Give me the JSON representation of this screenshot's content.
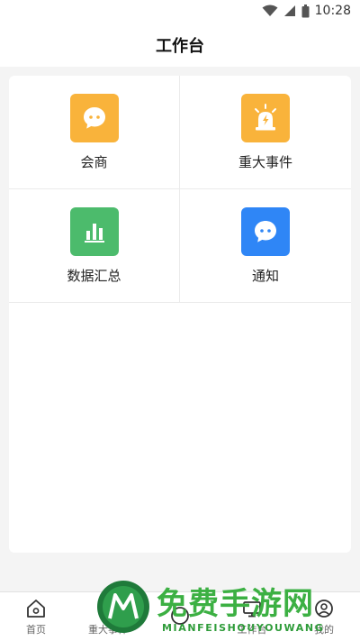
{
  "status_bar": {
    "time": "10:28",
    "icons": [
      "wifi-icon",
      "signal-icon",
      "battery-icon"
    ]
  },
  "header": {
    "title": "工作台"
  },
  "tiles": [
    {
      "label": "会商",
      "icon": "chat-bubble-icon",
      "color": "#f9b33b"
    },
    {
      "label": "重大事件",
      "icon": "alarm-light-icon",
      "color": "#f9b33b"
    },
    {
      "label": "数据汇总",
      "icon": "bar-chart-icon",
      "color": "#4cbb6c"
    },
    {
      "label": "通知",
      "icon": "message-icon",
      "color": "#2f86f6"
    }
  ],
  "bottom_nav": {
    "items": [
      {
        "label": "首页",
        "icon": "home-icon"
      },
      {
        "label": "重大事件",
        "icon": "event-icon"
      },
      {
        "label": "",
        "icon": "center-icon"
      },
      {
        "label": "工作台",
        "icon": "workbench-icon"
      },
      {
        "label": "我的",
        "icon": "profile-icon"
      }
    ]
  },
  "watermark": {
    "title": "免费手游网",
    "subtitle": "MIANFEISHOUYOUWANG",
    "color": "#3cb043"
  }
}
